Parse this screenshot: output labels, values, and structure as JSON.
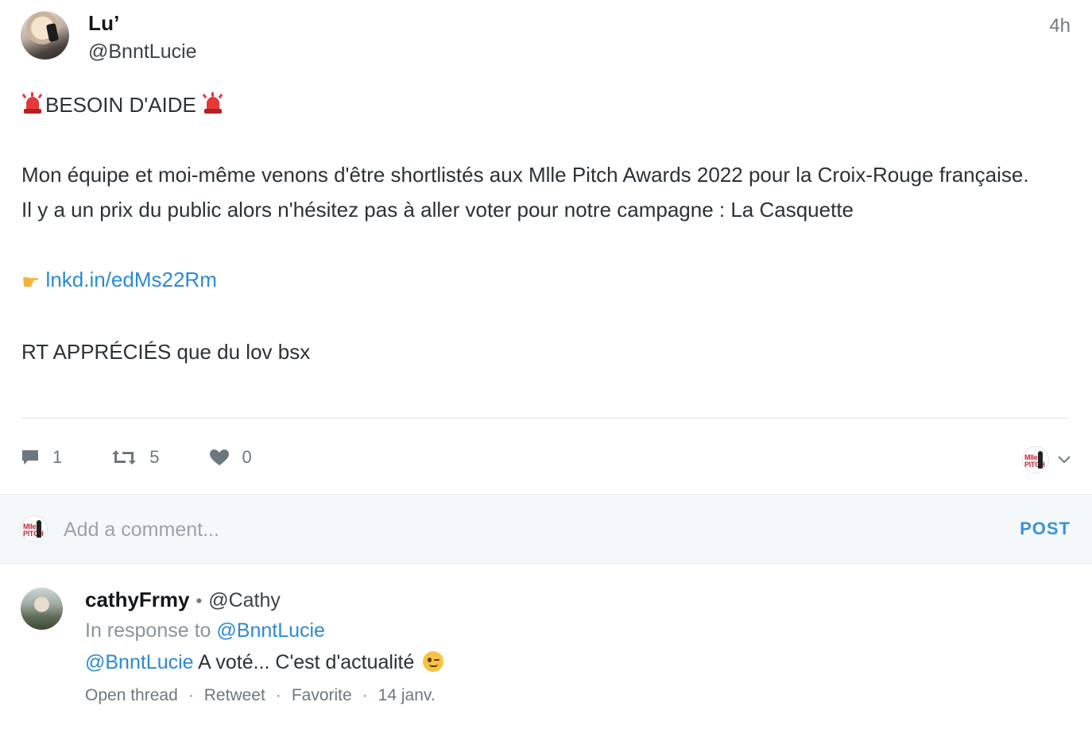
{
  "tweet": {
    "display_name": "Lu’",
    "handle": "@BnntLucie",
    "time": "4h",
    "line1": "BESOIN D'AIDE",
    "line2": "Mon équipe et moi-même venons d'être shortlistés aux Mlle Pitch Awards 2022 pour la Croix-Rouge française.",
    "line3": "Il y a un prix du public alors n'hésitez pas à aller voter pour notre campagne : La Casquette",
    "link": "lnkd.in/edMs22Rm",
    "line5": "RT APPRÉCIÉS que du lov bsx",
    "icons": {
      "avatar": "user-avatar-icon",
      "siren": "police-light-emoji-icon",
      "finger": "pointing-right-emoji-icon"
    }
  },
  "actions": {
    "reply_count": "1",
    "retweet_count": "5",
    "like_count": "0",
    "icons": [
      "comment-icon",
      "retweet-icon",
      "heart-icon",
      "chevron-down-icon"
    ]
  },
  "mini_avatar": {
    "logo_text": "Mlle PITCH"
  },
  "comment": {
    "placeholder": "Add a comment...",
    "post_label": "POST"
  },
  "reply": {
    "name": "cathyFrmy",
    "separator": "•",
    "handle": "@Cathy",
    "in_response_prefix": "In response to",
    "in_response_handle": "@BnntLucie",
    "mention": "@BnntLucie",
    "text": "A voté... C'est d'actualité",
    "actions": {
      "open_thread": "Open thread",
      "retweet": "Retweet",
      "favorite": "Favorite",
      "date": "14 janv.",
      "dot": "·"
    }
  },
  "colors": {
    "link": "#2b8ad6",
    "post": "#3a92d6",
    "muted": "#6d7780",
    "siren": "#e53838"
  }
}
